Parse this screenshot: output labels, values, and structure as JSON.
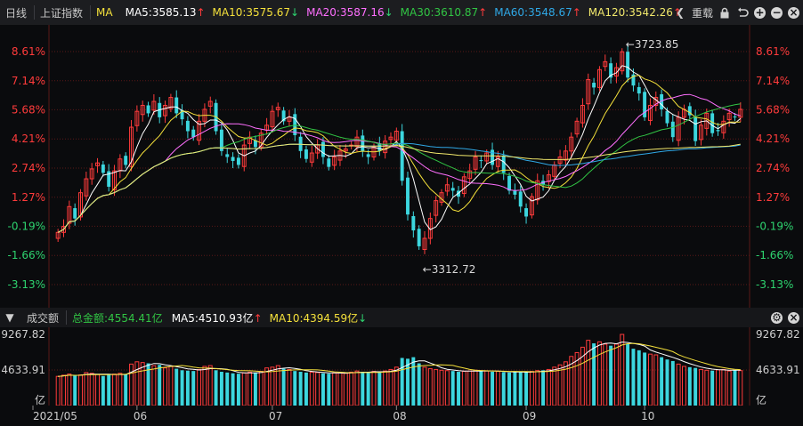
{
  "toolbar": {
    "period": "日线",
    "index_name": "上证指数",
    "ma_label": "MA",
    "ma5": "MA5:3585.13",
    "ma10": "MA10:3575.67",
    "ma20": "MA20:3587.16",
    "ma30": "MA30:3610.87",
    "ma60": "MA60:3548.67",
    "ma120": "MA120:3542.26",
    "ma5_dir": "↑",
    "ma10_dir": "↓",
    "ma20_dir": "↓",
    "ma30_dir": "↑",
    "ma60_dir": "↑",
    "ma120_dir": "↑",
    "overlay": "重载",
    "icons": [
      "chevron-left-icon",
      "lock-icon",
      "undo-icon",
      "plus-icon",
      "minus-icon",
      "close-icon"
    ]
  },
  "colors": {
    "ma5": "#ffffff",
    "ma10": "#f5e13b",
    "ma20": "#ff6fff",
    "ma30": "#31c544",
    "ma60": "#2fa8e6",
    "ma120": "#f2e96c",
    "up": "#ff3b3b",
    "down": "#3cd6de",
    "grid": "#5a1818"
  },
  "price_axis": {
    "labels": [
      "8.61%",
      "7.14%",
      "5.68%",
      "4.21%",
      "2.74%",
      "1.27%",
      "-0.19%",
      "-1.66%",
      "-3.13%"
    ]
  },
  "annotations": {
    "high_label": "←3723.85",
    "low_label": "←3312.72"
  },
  "volume": {
    "title": "成交额",
    "total": "总金额:4554.41亿",
    "ma5": "MA5:4510.93亿",
    "ma10": "MA10:4394.59亿",
    "ma5_dir": "↑",
    "ma10_dir": "↓",
    "axis_labels": [
      "9267.82",
      "4633.91",
      "亿"
    ]
  },
  "x_axis": {
    "labels": [
      "2021/05",
      "06",
      "07",
      "08",
      "09",
      "10"
    ]
  },
  "chart_data": {
    "type": "candlestick",
    "unit": "% change",
    "ylim": [
      -3.13,
      8.61
    ],
    "high_point": 3723.85,
    "low_point": 3312.72,
    "closes": [
      -0.5,
      -0.2,
      0.8,
      0.2,
      1.5,
      2.2,
      2.7,
      3.0,
      2.5,
      1.8,
      2.6,
      3.2,
      2.9,
      4.8,
      5.6,
      5.9,
      5.5,
      6.1,
      5.3,
      5.9,
      6.3,
      5.5,
      5.2,
      4.6,
      4.3,
      5.1,
      5.7,
      6.1,
      4.6,
      3.6,
      3.3,
      3.1,
      2.9,
      3.9,
      4.3,
      3.8,
      4.5,
      4.9,
      5.6,
      5.8,
      5.1,
      5.3,
      4.4,
      3.6,
      3.2,
      3.5,
      3.9,
      3.3,
      2.8,
      3.3,
      3.6,
      3.7,
      3.9,
      4.3,
      3.6,
      3.3,
      3.8,
      3.6,
      4.1,
      4.3,
      4.6,
      2.1,
      0.4,
      -0.4,
      -1.2,
      -0.8,
      0.2,
      1.1,
      1.5,
      1.9,
      1.6,
      1.3,
      2.3,
      2.6,
      3.3,
      3.1,
      3.5,
      2.9,
      3.3,
      2.5,
      1.6,
      1.4,
      0.8,
      0.3,
      1.3,
      2.1,
      1.9,
      2.4,
      2.9,
      3.3,
      3.6,
      4.3,
      5.1,
      5.9,
      7.2,
      6.8,
      7.7,
      8.1,
      7.3,
      7.8,
      8.6,
      7.3,
      6.9,
      6.5,
      5.3,
      5.9,
      6.3,
      5.7,
      5.0,
      4.3,
      5.3,
      5.7,
      5.4,
      4.1,
      4.9,
      5.5,
      4.5,
      4.6,
      5.1,
      5.5,
      5.3,
      5.7
    ],
    "volumes": [
      3800,
      3950,
      4100,
      3900,
      4000,
      4300,
      4200,
      4050,
      3850,
      4000,
      4100,
      4200,
      4050,
      5400,
      5700,
      5600,
      5500,
      5200,
      5300,
      4900,
      5100,
      4800,
      4600,
      4550,
      4500,
      4700,
      5100,
      5200,
      4600,
      4400,
      4300,
      4200,
      4150,
      4250,
      4350,
      4300,
      4450,
      4900,
      5000,
      5200,
      4800,
      4700,
      4500,
      4400,
      4300,
      4350,
      4300,
      4200,
      4150,
      4250,
      4300,
      4200,
      4350,
      4500,
      4400,
      4300,
      4450,
      4350,
      4500,
      4700,
      5000,
      6200,
      6100,
      6300,
      5500,
      5000,
      4800,
      4700,
      4600,
      4550,
      4500,
      4400,
      4450,
      4500,
      4600,
      4550,
      4500,
      4400,
      4450,
      4350,
      4300,
      4350,
      4400,
      4300,
      4450,
      4550,
      4600,
      4700,
      5000,
      5300,
      5700,
      6400,
      6900,
      7600,
      8500,
      8100,
      8300,
      8000,
      7800,
      8000,
      9267,
      8000,
      7400,
      7200,
      6900,
      6700,
      6600,
      6300,
      6000,
      5800,
      5400,
      5100,
      5000,
      4900,
      4700,
      4600,
      4550,
      4650,
      4700,
      4500,
      4600,
      4554
    ]
  }
}
